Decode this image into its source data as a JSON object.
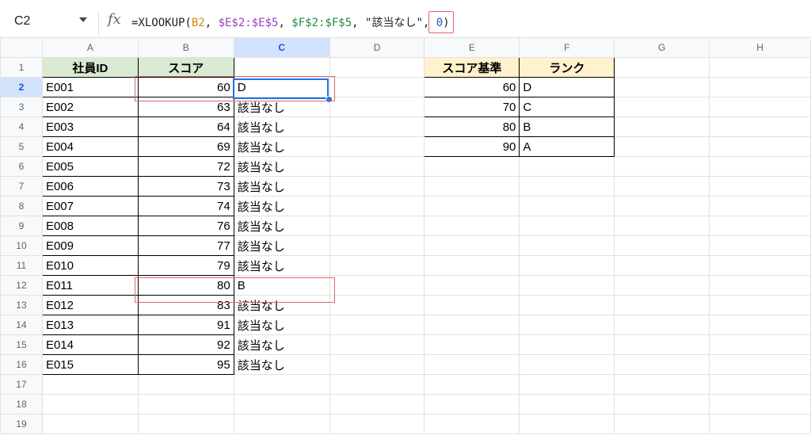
{
  "formula_bar": {
    "name_box": "C2",
    "fx_icon": "fx-icon",
    "formula_parts": {
      "p0": "=XLOOKUP(",
      "p1": "B2",
      "p2": ", ",
      "p3": "$E$2:$E$5",
      "p4": ", ",
      "p5": "$F$2:$F$5",
      "p6": ", ",
      "p7": "\"該当なし\"",
      "p8": ", ",
      "p9": "0",
      "p10": ")"
    }
  },
  "columns": [
    "A",
    "B",
    "C",
    "D",
    "E",
    "F",
    "G",
    "H"
  ],
  "active_cell": "C2",
  "headers": {
    "a1": "社員ID",
    "b1": "スコア",
    "e1": "スコア基準",
    "f1": "ランク"
  },
  "rows": [
    {
      "n": "1"
    },
    {
      "n": "2",
      "a": "E001",
      "b": "60",
      "c": "D",
      "e": "60",
      "f": "D"
    },
    {
      "n": "3",
      "a": "E002",
      "b": "63",
      "c": "該当なし",
      "e": "70",
      "f": "C"
    },
    {
      "n": "4",
      "a": "E003",
      "b": "64",
      "c": "該当なし",
      "e": "80",
      "f": "B"
    },
    {
      "n": "5",
      "a": "E004",
      "b": "69",
      "c": "該当なし",
      "e": "90",
      "f": "A"
    },
    {
      "n": "6",
      "a": "E005",
      "b": "72",
      "c": "該当なし"
    },
    {
      "n": "7",
      "a": "E006",
      "b": "73",
      "c": "該当なし"
    },
    {
      "n": "8",
      "a": "E007",
      "b": "74",
      "c": "該当なし"
    },
    {
      "n": "9",
      "a": "E008",
      "b": "76",
      "c": "該当なし"
    },
    {
      "n": "10",
      "a": "E009",
      "b": "77",
      "c": "該当なし"
    },
    {
      "n": "11",
      "a": "E010",
      "b": "79",
      "c": "該当なし"
    },
    {
      "n": "12",
      "a": "E011",
      "b": "80",
      "c": "B"
    },
    {
      "n": "13",
      "a": "E012",
      "b": "83",
      "c": "該当なし"
    },
    {
      "n": "14",
      "a": "E013",
      "b": "91",
      "c": "該当なし"
    },
    {
      "n": "15",
      "a": "E014",
      "b": "92",
      "c": "該当なし"
    },
    {
      "n": "16",
      "a": "E015",
      "b": "95",
      "c": "該当なし"
    },
    {
      "n": "17"
    },
    {
      "n": "18"
    },
    {
      "n": "19"
    }
  ],
  "colors": {
    "header_green": "#d9ead3",
    "header_yellow": "#fff2cc",
    "selection_blue": "#1a73e8",
    "highlight_red": "#e06666"
  }
}
